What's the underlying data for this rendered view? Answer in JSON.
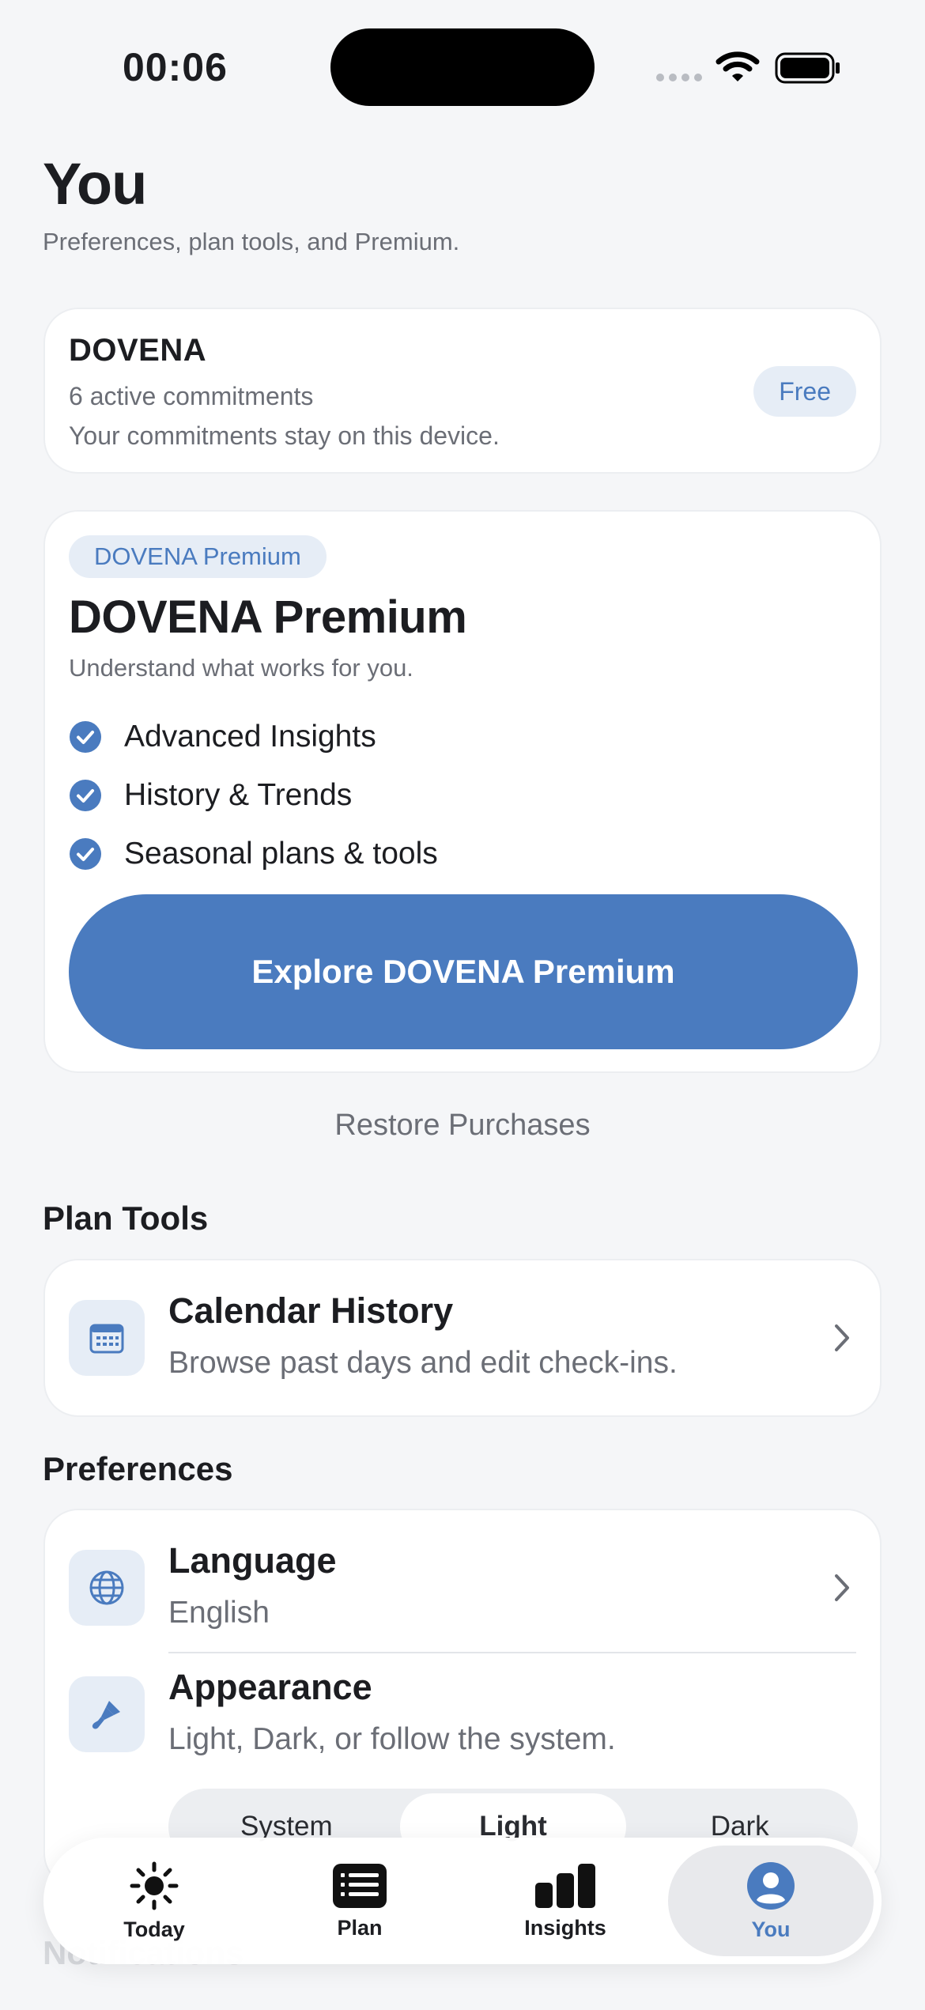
{
  "status_bar": {
    "time": "00:06"
  },
  "header": {
    "title": "You",
    "subtitle": "Preferences, plan tools, and Premium."
  },
  "account": {
    "name": "DOVENA",
    "commitments": "6 active commitments",
    "storage_note": "Your commitments stay on this device.",
    "plan_badge": "Free"
  },
  "premium": {
    "chip": "DOVENA Premium",
    "title": "DOVENA Premium",
    "tagline": "Understand what works for you.",
    "features": [
      "Advanced Insights",
      "History & Trends",
      "Seasonal plans & tools"
    ],
    "cta": "Explore DOVENA Premium"
  },
  "restore_label": "Restore Purchases",
  "plan_tools": {
    "section_title": "Plan Tools",
    "calendar": {
      "title": "Calendar History",
      "subtitle": "Browse past days and edit check-ins."
    }
  },
  "preferences": {
    "section_title": "Preferences",
    "language": {
      "title": "Language",
      "value": "English"
    },
    "appearance": {
      "title": "Appearance",
      "subtitle": "Light, Dark, or follow the system.",
      "options": [
        "System",
        "Light",
        "Dark"
      ],
      "selected": "Light"
    }
  },
  "notifications_section_title": "Notifications",
  "tab_bar": {
    "tabs": [
      {
        "label": "Today",
        "icon": "sun-icon"
      },
      {
        "label": "Plan",
        "icon": "list-icon"
      },
      {
        "label": "Insights",
        "icon": "bar-chart-icon"
      },
      {
        "label": "You",
        "icon": "person-icon"
      }
    ],
    "active": "You"
  },
  "colors": {
    "accent": "#4a7bbf",
    "accent_tint": "#e6edf6",
    "background": "#f5f6f8",
    "text_secondary": "#6b6e76"
  }
}
